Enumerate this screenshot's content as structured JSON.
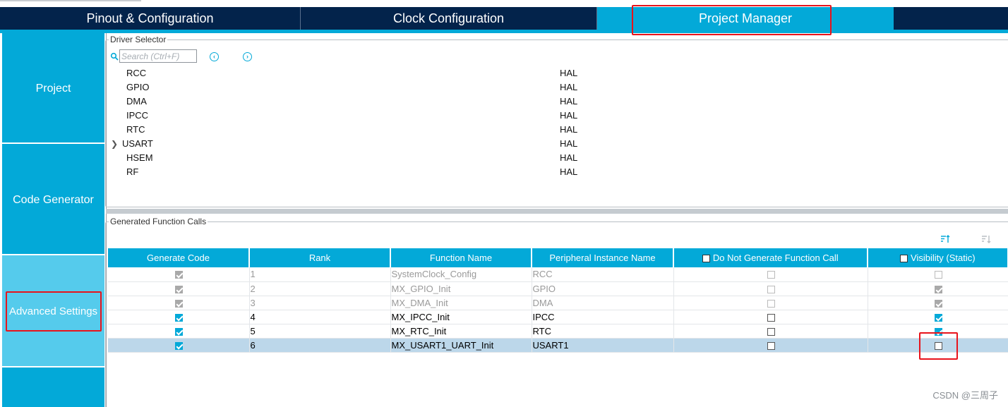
{
  "tabs": [
    {
      "label": "Pinout & Configuration",
      "active": false
    },
    {
      "label": "Clock Configuration",
      "active": false
    },
    {
      "label": "Project Manager",
      "active": true
    }
  ],
  "sidebar": {
    "items": [
      {
        "label": "Project",
        "selected": false
      },
      {
        "label": "Code Generator",
        "selected": false
      },
      {
        "label": "Advanced Settings",
        "selected": true
      }
    ]
  },
  "driver_selector": {
    "title": "Driver Selector",
    "search_placeholder": "Search (Ctrl+F)",
    "rows": [
      {
        "name": "RCC",
        "value": "HAL",
        "expandable": false
      },
      {
        "name": "GPIO",
        "value": "HAL",
        "expandable": false
      },
      {
        "name": "DMA",
        "value": "HAL",
        "expandable": false
      },
      {
        "name": "IPCC",
        "value": "HAL",
        "expandable": false
      },
      {
        "name": "RTC",
        "value": "HAL",
        "expandable": false
      },
      {
        "name": "USART",
        "value": "HAL",
        "expandable": true
      },
      {
        "name": "HSEM",
        "value": "HAL",
        "expandable": false
      },
      {
        "name": "RF",
        "value": "HAL",
        "expandable": false
      }
    ]
  },
  "generated_calls": {
    "title": "Generated Function Calls",
    "columns": [
      "Generate Code",
      "Rank",
      "Function Name",
      "Peripheral Instance Name",
      "Do Not Generate Function Call",
      "Visibility (Static)"
    ],
    "rows": [
      {
        "generate": true,
        "rank": "1",
        "function": "SystemClock_Config",
        "instance": "RCC",
        "do_not_generate": false,
        "visibility": false,
        "disabled": true,
        "selected": false
      },
      {
        "generate": true,
        "rank": "2",
        "function": "MX_GPIO_Init",
        "instance": "GPIO",
        "do_not_generate": false,
        "visibility": true,
        "disabled": true,
        "selected": false
      },
      {
        "generate": true,
        "rank": "3",
        "function": "MX_DMA_Init",
        "instance": "DMA",
        "do_not_generate": false,
        "visibility": true,
        "disabled": true,
        "selected": false
      },
      {
        "generate": true,
        "rank": "4",
        "function": "MX_IPCC_Init",
        "instance": "IPCC",
        "do_not_generate": false,
        "visibility": true,
        "disabled": false,
        "selected": false
      },
      {
        "generate": true,
        "rank": "5",
        "function": "MX_RTC_Init",
        "instance": "RTC",
        "do_not_generate": false,
        "visibility": true,
        "disabled": false,
        "selected": false
      },
      {
        "generate": true,
        "rank": "6",
        "function": "MX_USART1_UART_Init",
        "instance": "USART1",
        "do_not_generate": false,
        "visibility": false,
        "disabled": false,
        "selected": true
      }
    ]
  },
  "watermark": "CSDN @三周子",
  "colors": {
    "accent": "#03a9d8",
    "navy": "#03234b",
    "highlight": "#e8131b",
    "selected_row": "#bcd7ea"
  }
}
